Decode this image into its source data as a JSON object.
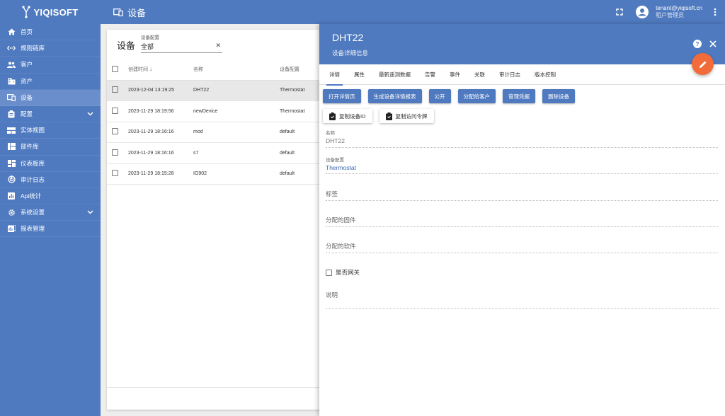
{
  "brand": {
    "name": "YIQISOFT"
  },
  "header": {
    "title": "设备"
  },
  "user": {
    "email": "tenant@yiqisoft.cn",
    "role": "租户管理员"
  },
  "sidebar": {
    "items": [
      {
        "label": "首页",
        "icon": "home-icon"
      },
      {
        "label": "规则链库",
        "icon": "code-icon"
      },
      {
        "label": "客户",
        "icon": "people-icon"
      },
      {
        "label": "资产",
        "icon": "domain-icon"
      },
      {
        "label": "设备",
        "icon": "devices-icon",
        "active": true
      },
      {
        "label": "配置",
        "icon": "config-icon",
        "expandable": true
      },
      {
        "label": "实体视图",
        "icon": "view-quilt-icon"
      },
      {
        "label": "部件库",
        "icon": "widgets-icon"
      },
      {
        "label": "仪表板库",
        "icon": "dashboard-icon"
      },
      {
        "label": "审计日志",
        "icon": "track-changes-icon"
      },
      {
        "label": "Api统计",
        "icon": "chart-icon"
      },
      {
        "label": "系统设置",
        "icon": "gear-icon",
        "expandable": true
      },
      {
        "label": "报表管理",
        "icon": "report-icon"
      }
    ]
  },
  "list": {
    "title": "设备",
    "filter": {
      "label": "设备配置",
      "value": "全部"
    },
    "columns": {
      "time": "创建时间",
      "name": "名称",
      "profile": "设备配置"
    },
    "rows": [
      {
        "time": "2023-12-04 13:19:25",
        "name": "DHT22",
        "profile": "Thermostat",
        "selected": true
      },
      {
        "time": "2023-11-29 18:19:56",
        "name": "newDevice",
        "profile": "Thermostat"
      },
      {
        "time": "2023-11-29 18:16:16",
        "name": "mod",
        "profile": "default"
      },
      {
        "time": "2023-11-29 18:16:16",
        "name": "s7",
        "profile": "default"
      },
      {
        "time": "2023-11-29 18:15:28",
        "name": "IG902",
        "profile": "default"
      }
    ]
  },
  "panel": {
    "title": "DHT22",
    "subtitle": "设备详细信息",
    "tabs": [
      "详情",
      "属性",
      "最新遥测数据",
      "告警",
      "事件",
      "关联",
      "审计日志",
      "版本控制"
    ],
    "buttons": [
      "打开详情页",
      "生成设备详情报表",
      "公开",
      "分配给客户",
      "管理凭据",
      "删除设备"
    ],
    "copy_buttons": [
      "复制设备ID",
      "复制访问令牌"
    ],
    "fields": {
      "name_label": "名称",
      "name_value": "DHT22",
      "profile_label": "设备配置",
      "profile_value": "Thermostat",
      "label_placeholder": "标签",
      "firmware_placeholder": "分配的固件",
      "software_placeholder": "分配的软件",
      "gateway_label": "是否网关",
      "description_placeholder": "说明"
    }
  },
  "colors": {
    "primary": "#4f7abf",
    "accent": "#f26b3a"
  }
}
